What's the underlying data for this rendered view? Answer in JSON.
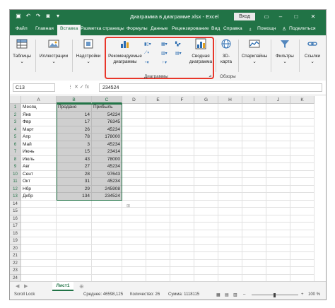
{
  "title_bar": {
    "title": "Диаграмма в диаграмме.xlsx - Excel",
    "login": "Вход",
    "icons": [
      "save-icon",
      "undo-icon",
      "redo-icon",
      "camera-icon",
      "customize-icon"
    ]
  },
  "tabs": [
    "Файл",
    "Главная",
    "Вставка",
    "Разметка страницы",
    "Формулы",
    "Данные",
    "Рецензирование",
    "Вид",
    "Справка",
    "Помощн",
    "Поделиться"
  ],
  "active_tab": "Вставка",
  "ribbon": {
    "tables": "Таблицы",
    "illustrations": "Иллюстрации",
    "addins": "Надстройки",
    "recommended_line1": "Рекомендуемые",
    "recommended_line2": "диаграммы",
    "pivot_line1": "Сводная",
    "pivot_line2": "диаграмма",
    "charts_group": "Диаграммы",
    "map_line1": "3D-",
    "map_line2": "карта",
    "tours_group": "Обзоры",
    "sparklines": "Спарклайны",
    "filters": "Фильтры",
    "links": "Ссылки"
  },
  "formula_bar": {
    "name_box": "C13",
    "icons": "⋮   ✕   ✓   fx",
    "value": "234524"
  },
  "columns": [
    "A",
    "B",
    "C",
    "D",
    "E",
    "F",
    "G",
    "H",
    "I",
    "J",
    "K"
  ],
  "rows": [
    "1",
    "2",
    "3",
    "4",
    "5",
    "6",
    "7",
    "8",
    "9",
    "10",
    "11",
    "12",
    "13",
    "14",
    "15",
    "16",
    "17",
    "18",
    "19",
    "20",
    "21",
    "22",
    "23",
    "24"
  ],
  "table": {
    "headers": [
      "Месяц",
      "Продано",
      "Прибыль"
    ],
    "data": [
      [
        "Янв",
        "14",
        "54234"
      ],
      [
        "Фвр",
        "17",
        "76345"
      ],
      [
        "Март",
        "26",
        "45234"
      ],
      [
        "Апр",
        "78",
        "178000"
      ],
      [
        "Май",
        "3",
        "45234"
      ],
      [
        "Июнь",
        "15",
        "23414"
      ],
      [
        "Июль",
        "43",
        "78000"
      ],
      [
        "Авг",
        "27",
        "45234"
      ],
      [
        "Сент",
        "28",
        "97643"
      ],
      [
        "Окт",
        "31",
        "45234"
      ],
      [
        "Нбр",
        "29",
        "245908"
      ],
      [
        "Дкбр",
        "134",
        "234524"
      ]
    ]
  },
  "sheet_tab": "Лист1",
  "status": {
    "left": "Scroll Lock",
    "average": "Среднее: 46598,125",
    "count": "Количество: 26",
    "sum": "Сумма: 1118115",
    "zoom": "100 %"
  }
}
